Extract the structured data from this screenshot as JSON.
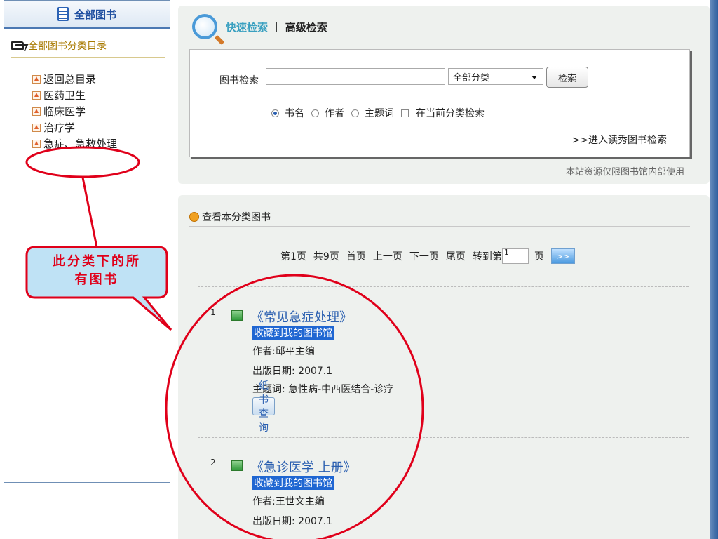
{
  "sidebar": {
    "header_title": "全部图书",
    "catalog_label": "全部图书分类目录",
    "items": [
      {
        "label": "返回总目录"
      },
      {
        "label": "医药卫生"
      },
      {
        "label": "临床医学"
      },
      {
        "label": "治疗学"
      },
      {
        "label": "急症、急救处理"
      }
    ]
  },
  "search": {
    "tab_quick": "快速检索",
    "tab_separator": "|",
    "tab_advanced": "高级检索",
    "field_label": "图书检索",
    "input_value": "",
    "category_selected": "全部分类",
    "button_label": "检索",
    "options": [
      {
        "label": "书名",
        "selected": true
      },
      {
        "label": "作者",
        "selected": false
      },
      {
        "label": "主题词",
        "selected": false
      }
    ],
    "checkbox_label": "在当前分类检索",
    "duxiu_link": ">>进入读秀图书检索",
    "notice": "本站资源仅限图书馆内部使用"
  },
  "results": {
    "header": "查看本分类图书",
    "pager": {
      "current": "第1页",
      "total": "共9页",
      "first": "首页",
      "prev": "上一页",
      "next": "下一页",
      "last": "尾页",
      "goto_label": "转到第",
      "goto_value": "1",
      "page_suffix": "页",
      "go_label": ">>"
    },
    "books": [
      {
        "num": "1",
        "title": "《常见急症处理》",
        "fav": "收藏到我的图书馆",
        "author": "作者:邱平主编",
        "date": "出版日期: 2007.1",
        "subject": "主题词: 急性病-中西医结合-诊疗",
        "paper_btn": "纸书查询"
      },
      {
        "num": "2",
        "title": "《急诊医学 上册》",
        "fav": "收藏到我的图书馆",
        "author": "作者:王世文主编",
        "date": "出版日期: 2007.1"
      }
    ]
  },
  "annotation": {
    "callout_line1": "此分类下的所",
    "callout_line2": "有图书",
    "color": "#e0001a"
  }
}
